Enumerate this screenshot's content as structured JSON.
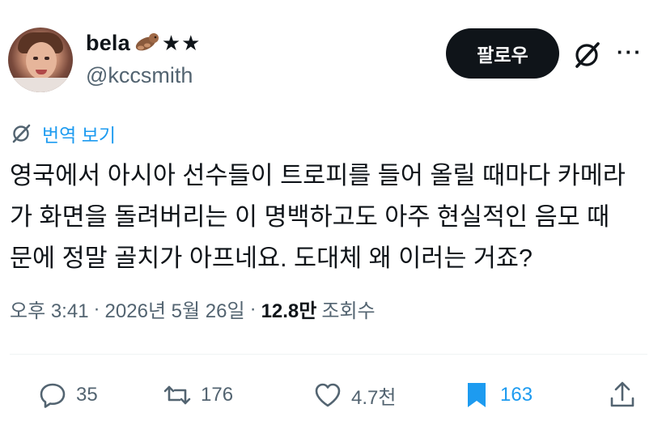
{
  "author": {
    "display_name": "bela",
    "display_name_emoji": "otter-emoji",
    "display_name_suffix": "★★",
    "handle": "@kccsmith"
  },
  "header_actions": {
    "follow_label": "팔로우",
    "grok_icon": "grok-icon",
    "more_label": "···"
  },
  "translate_label": "번역 보기",
  "tweet_text": "영국에서 아시아 선수들이 트로피를 들어 올릴 때마다 카메라\n가 화면을 돌려버리는 이 명백하고도 아주 현실적인 음모 때\n문에 정말 골치가 아프네요. 도대체 왜 이러는 거죠?",
  "meta": {
    "time": "오후 3:41",
    "date": "2026년 5월 26일",
    "separator": "·",
    "views_count": "12.8만",
    "views_label": "조회수"
  },
  "actions": {
    "replies": "35",
    "reposts": "176",
    "likes": "4.7천",
    "bookmarks": "163"
  },
  "colors": {
    "accent": "#1d9bf0",
    "text": "#0f1419",
    "secondary": "#536471",
    "follow_bg": "#0f1419"
  }
}
